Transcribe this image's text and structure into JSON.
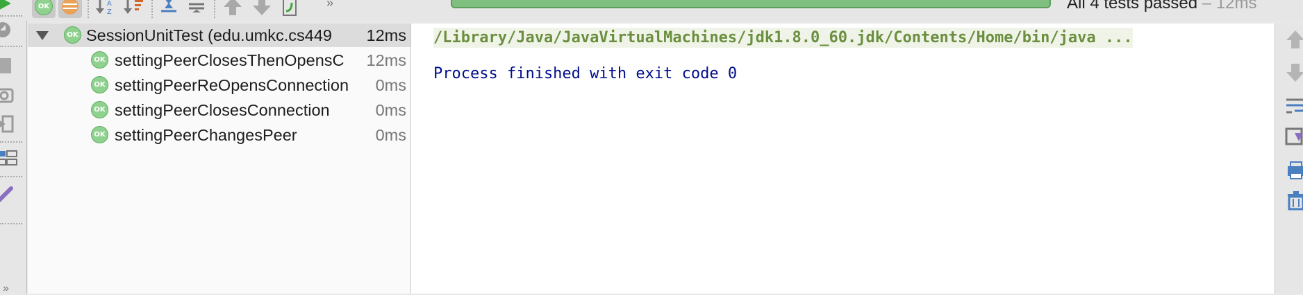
{
  "toolbar": {
    "status_text": "All 4 tests passed",
    "status_time": "– 12ms",
    "more_label": "»"
  },
  "left_toolbar": {
    "more_label": "»"
  },
  "tree": {
    "ok_badge": "OK",
    "root": {
      "name": "SessionUnitTest (edu.umkc.cs449",
      "time": "12ms"
    },
    "tests": [
      {
        "name": "settingPeerClosesThenOpensC",
        "time": "12ms"
      },
      {
        "name": "settingPeerReOpensConnection",
        "time": "0ms"
      },
      {
        "name": "settingPeerClosesConnection",
        "time": "0ms"
      },
      {
        "name": "settingPeerChangesPeer",
        "time": "0ms"
      }
    ]
  },
  "console": {
    "command_line": "/Library/Java/JavaVirtualMachines/jdk1.8.0_60.jdk/Contents/Home/bin/java ...",
    "exit_line": "Process finished with exit code 0"
  },
  "colors": {
    "pass_green": "#8fd18f",
    "progress_green": "#7fbf7f",
    "console_blue": "#000e8a",
    "command_green": "#6b8f3f"
  }
}
